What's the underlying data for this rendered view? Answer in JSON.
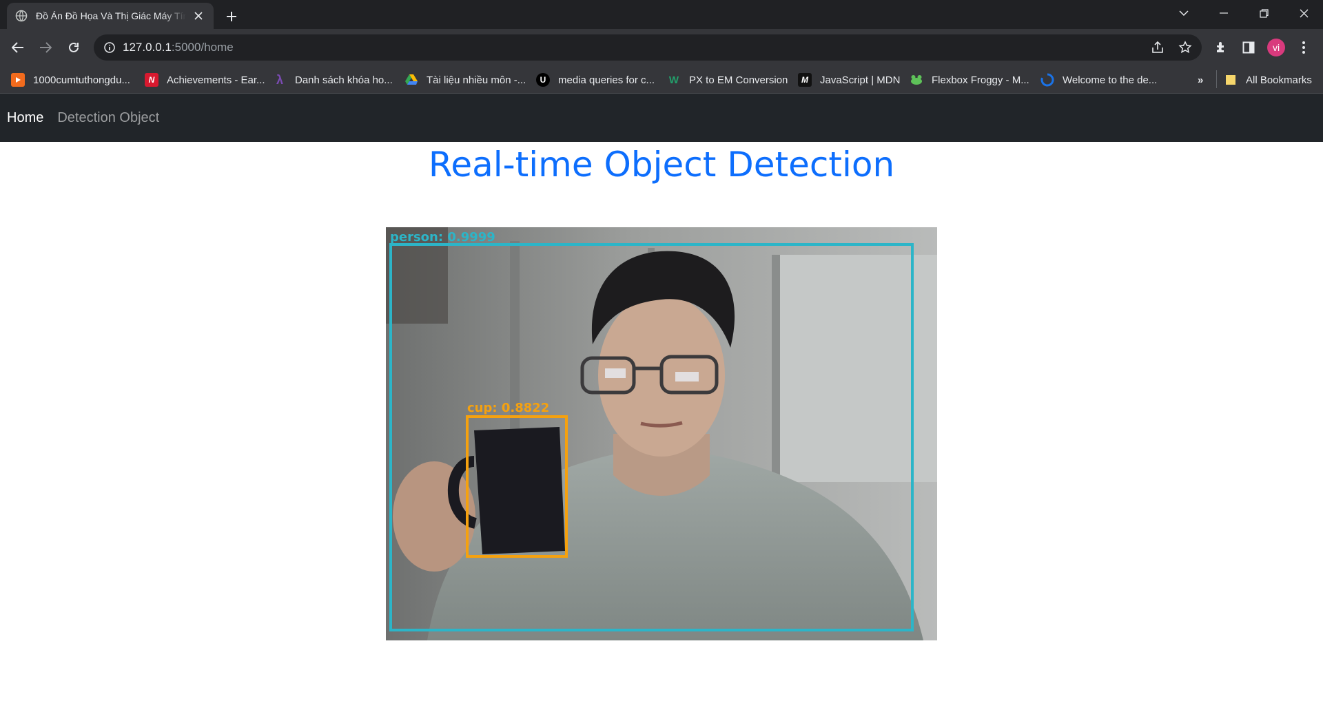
{
  "browser": {
    "tab_title": "Đồ Án Đồ Họa Và Thị Giác Máy Tính",
    "url_host": "127.0.0.1",
    "url_path": ":5000/home",
    "profile_initials": "vi",
    "bookmarks": [
      {
        "label": "1000cumtuthongdu...",
        "icon": "play-icon",
        "color": "#f26b1d"
      },
      {
        "label": "Achievements - Ear...",
        "icon": "n-icon",
        "color": "#d8192f"
      },
      {
        "label": "Danh sách khóa ho...",
        "icon": "lambda-icon",
        "color": "#5b2a86"
      },
      {
        "label": "Tài liệu nhiều môn -...",
        "icon": "drive-icon",
        "color": "#34a853"
      },
      {
        "label": "media queries for c...",
        "icon": "u-icon",
        "color": "#000000"
      },
      {
        "label": "PX to EM Conversion",
        "icon": "w-icon",
        "color": "#22a06b"
      },
      {
        "label": "JavaScript | MDN",
        "icon": "mdn-icon",
        "color": "#000000"
      },
      {
        "label": "Flexbox Froggy - M...",
        "icon": "frog-icon",
        "color": "#5ec259"
      },
      {
        "label": "Welcome to the de...",
        "icon": "swirl-icon",
        "color": "#1a73e8"
      }
    ],
    "all_bookmarks_label": "All Bookmarks",
    "overflow_label": "»"
  },
  "nav": {
    "home_label": "Home",
    "detection_label": "Detection Object"
  },
  "page": {
    "heading": "Real-time Object Detection"
  },
  "detections": [
    {
      "label": "person: 0.9999",
      "color": "#2cb5c8"
    },
    {
      "label": "cup: 0.8822",
      "color": "#f5a10f"
    }
  ]
}
